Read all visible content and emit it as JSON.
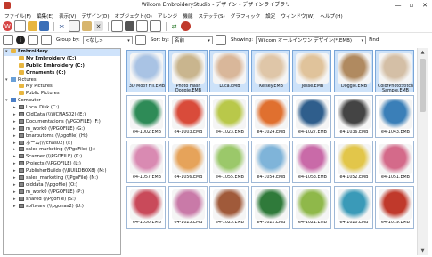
{
  "window": {
    "title": "Wilcom EmbroideryStudio - デザイン - デザインライブラリ",
    "controls": [
      "—",
      "▫",
      "✕"
    ]
  },
  "menu": [
    "ファイル(F)",
    "編集(E)",
    "表示(V)",
    "デザイン(D)",
    "オブジェクト(O)",
    "アレンジ",
    "機能",
    "ステッチ(S)",
    "グラフィック",
    "設定",
    "ウィンドウ(W)",
    "ヘルプ(H)"
  ],
  "filterbar": {
    "group_by_label": "Group by:",
    "group_by_value": "<なし>",
    "sort_by_label": "Sort by:",
    "sort_by_value": "名前",
    "showing_label": "Showing:",
    "showing_value": "Wilcom オールインワン デザイン(*.EMB)",
    "find_label": "Find"
  },
  "tree": [
    {
      "label": "Embroidery",
      "level": 0,
      "icon": "folder",
      "bold": true,
      "expander": "▾"
    },
    {
      "label": "My Embroidery (C:)",
      "level": 1,
      "icon": "folder",
      "bold": true
    },
    {
      "label": "Public Embroidery (C:)",
      "level": 1,
      "icon": "folder",
      "bold": true
    },
    {
      "label": "Ornaments (C:)",
      "level": 1,
      "icon": "folder",
      "bold": true
    },
    {
      "label": "Pictures",
      "level": 0,
      "icon": "pics",
      "expander": "▾"
    },
    {
      "label": "My Pictures",
      "level": 1,
      "icon": "folder"
    },
    {
      "label": "Public Pictures",
      "level": 1,
      "icon": "folder"
    },
    {
      "label": "Computer",
      "level": 0,
      "icon": "pc",
      "expander": "▾"
    },
    {
      "label": "Local Disk (C:)",
      "level": 1,
      "icon": "drive",
      "expander": "▸"
    },
    {
      "label": "OldData (\\\\WCNAS02) (E:)",
      "level": 1,
      "icon": "drive",
      "expander": "▸"
    },
    {
      "label": "Documentations (\\\\PGOFILE) (F:)",
      "level": 1,
      "icon": "drive",
      "expander": "▸"
    },
    {
      "label": "m_work0 (\\\\PGOFILE) (G:)",
      "level": 1,
      "icon": "drive",
      "expander": "▸"
    },
    {
      "label": "bnarbutoms (\\\\pgofile) (H:)",
      "level": 1,
      "icon": "drive",
      "expander": "▸"
    },
    {
      "label": "ホーム(\\\\fcnas02) (I:)",
      "level": 1,
      "icon": "drive",
      "expander": "▸"
    },
    {
      "label": "sales-marketing (\\\\PgoFile) (J:)",
      "level": 1,
      "icon": "drive",
      "expander": "▸"
    },
    {
      "label": "Scanner (\\\\PGOFILE) (K:)",
      "level": 1,
      "icon": "drive",
      "expander": "▸"
    },
    {
      "label": "Projects (\\\\PGOFILE) (L:)",
      "level": 1,
      "icon": "drive",
      "expander": "▸"
    },
    {
      "label": "PublisherBuilds (\\\\BUILDBOX8) (M:)",
      "level": 1,
      "icon": "drive",
      "expander": "▸"
    },
    {
      "label": "sales_marketing (\\\\PgoFile) (N:)",
      "level": 1,
      "icon": "drive",
      "expander": "▸"
    },
    {
      "label": "olddata (\\\\pgofile) (O:)",
      "level": 1,
      "icon": "drive",
      "expander": "▸"
    },
    {
      "label": "m_work0 (\\\\PGOFILE) (P:)",
      "level": 1,
      "icon": "drive",
      "expander": "▸"
    },
    {
      "label": "shared (\\\\PgoFile) (S:)",
      "level": 1,
      "icon": "drive",
      "expander": "▸"
    },
    {
      "label": "software (\\\\pgonas2) (U:)",
      "level": 1,
      "icon": "drive",
      "expander": "▸"
    }
  ],
  "designs": [
    {
      "caption": "3D Motif Fill.EMB",
      "color": "#a9c3e4"
    },
    {
      "caption": "Photo Flash Doggie.EMB",
      "color": "#c9b58e"
    },
    {
      "caption": "Luca.EMB",
      "color": "#d9b79a"
    },
    {
      "caption": "Kelsey.EMB",
      "color": "#dfc6a8"
    },
    {
      "caption": "Jesse.EMB",
      "color": "#e0c39b"
    },
    {
      "caption": "Doggie.EMB",
      "color": "#b08a60"
    },
    {
      "caption": "ColorPhotoStitch Sample.EMB",
      "color": "#d4bfa6"
    },
    {
      "caption": "e4-1002.EMB",
      "color": "#2e8b57"
    },
    {
      "caption": "e4-1003.EMB",
      "color": "#d94b3a"
    },
    {
      "caption": "e4-1023.EMB",
      "color": "#b9c84a"
    },
    {
      "caption": "e4-1024.EMB",
      "color": "#e0702f"
    },
    {
      "caption": "e4-1027.EMB",
      "color": "#2f5e8c"
    },
    {
      "caption": "e4-1036.EMB",
      "color": "#444444"
    },
    {
      "caption": "e4-1043.EMB",
      "color": "#3a7fb8"
    },
    {
      "caption": "e4-1057.EMB",
      "color": "#d98ab2"
    },
    {
      "caption": "e4-1056.EMB",
      "color": "#e6a35a"
    },
    {
      "caption": "e4-1055.EMB",
      "color": "#9bc86a"
    },
    {
      "caption": "e4-1054.EMB",
      "color": "#7fb4d9"
    },
    {
      "caption": "e4-1053.EMB",
      "color": "#c96aa8"
    },
    {
      "caption": "e4-1052.EMB",
      "color": "#e2c64a"
    },
    {
      "caption": "e4-1051.EMB",
      "color": "#d46a8a"
    },
    {
      "caption": "e4-1050.EMB",
      "color": "#c94a5a"
    },
    {
      "caption": "e4-1025.EMB",
      "color": "#c97aa8"
    },
    {
      "caption": "e4-1023.EMB",
      "color": "#a05a3a"
    },
    {
      "caption": "e4-1022.EMB",
      "color": "#2f7a3a"
    },
    {
      "caption": "e4-1021.EMB",
      "color": "#8fb84a"
    },
    {
      "caption": "e4-1020.EMB",
      "color": "#3a9ab8"
    },
    {
      "caption": "e4-1019.EMB",
      "color": "#c0392b"
    }
  ]
}
